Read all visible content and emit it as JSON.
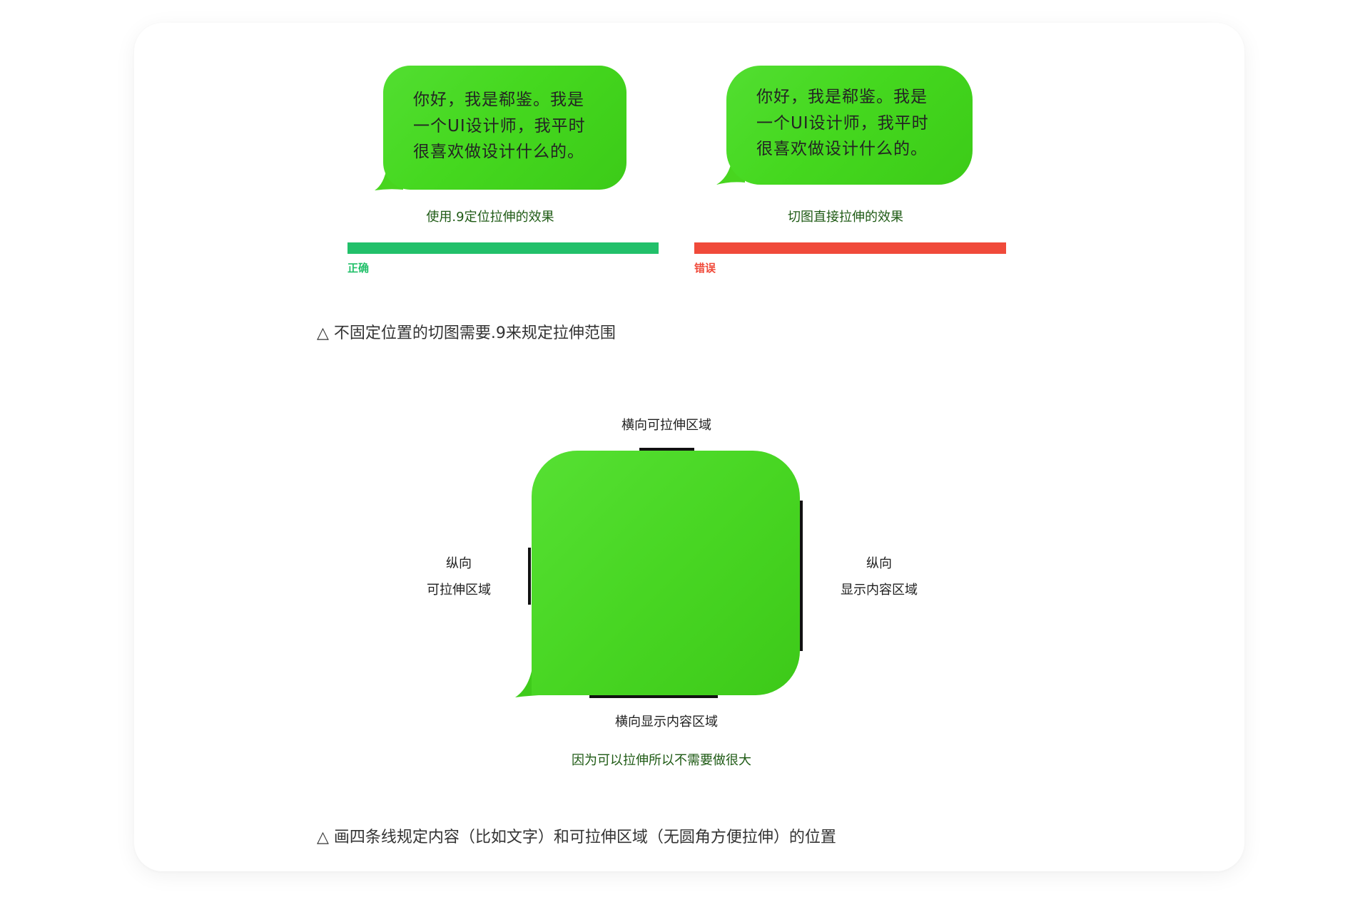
{
  "bubble_text": [
    "你好，我是郗鉴。我是",
    "一个UI设计师，我平时",
    "很喜欢做设计什么的。"
  ],
  "left_example": {
    "caption": "使用.9定位拉伸的效果",
    "tag": "正确",
    "color": "#22c06a"
  },
  "right_example": {
    "caption": "切图直接拉伸的效果",
    "tag": "错误",
    "color": "#f04a3a"
  },
  "note1": "△ 不固定位置的切图需要.9来规定拉伸范围",
  "diagram": {
    "top_label": "横向可拉伸区域",
    "left_label": [
      "纵向",
      "可拉伸区域"
    ],
    "right_label": [
      "纵向",
      "显示内容区域"
    ],
    "bottom_label": "横向显示内容区域",
    "green_caption": "因为可以拉伸所以不需要做很大",
    "bubble_color": "#46d822"
  },
  "note2": "△ 画四条线规定内容（比如文字）和可拉伸区域（无圆角方便拉伸）的位置"
}
